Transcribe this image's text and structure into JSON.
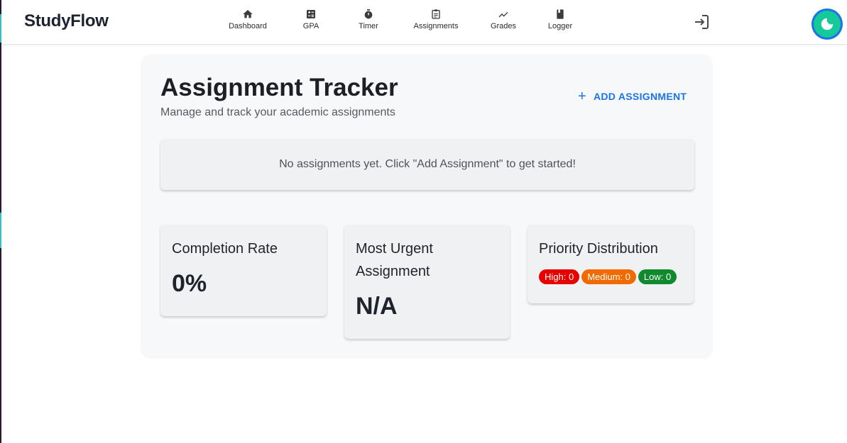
{
  "app": {
    "brand": "StudyFlow"
  },
  "nav": {
    "items": [
      {
        "label": "Dashboard",
        "icon": "home-icon"
      },
      {
        "label": "GPA",
        "icon": "calculator-icon"
      },
      {
        "label": "Timer",
        "icon": "stopwatch-icon"
      },
      {
        "label": "Assignments",
        "icon": "clipboard-icon"
      },
      {
        "label": "Grades",
        "icon": "trending-line-icon"
      },
      {
        "label": "Logger",
        "icon": "book-icon"
      }
    ],
    "logout_icon": "login-arrow-icon",
    "theme_icon": "moon-icon"
  },
  "page": {
    "title": "Assignment Tracker",
    "subtitle": "Manage and track your academic assignments",
    "add_button": "ADD ASSIGNMENT",
    "empty_message": "No assignments yet. Click \"Add Assignment\" to get started!"
  },
  "stats": {
    "completion": {
      "title": "Completion Rate",
      "value": "0%"
    },
    "urgent": {
      "title": "Most Urgent Assignment",
      "value": "N/A"
    },
    "priority": {
      "title": "Priority Distribution",
      "badges": [
        {
          "label": "High: 0",
          "color": "#e60000"
        },
        {
          "label": "Medium: 0",
          "color": "#f06a00"
        },
        {
          "label": "Low: 0",
          "color": "#118a2e"
        }
      ]
    }
  },
  "colors": {
    "accent": "#1a73e8",
    "toggle_inner": "#14c99a"
  }
}
